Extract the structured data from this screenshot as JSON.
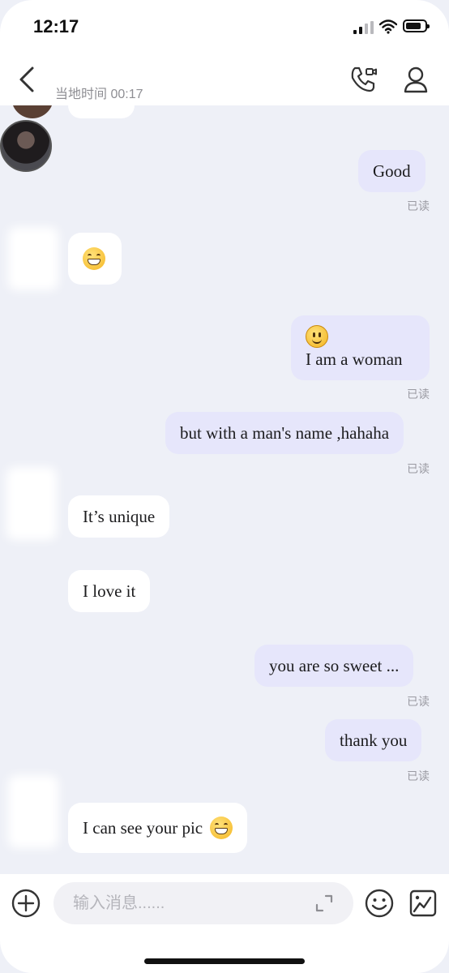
{
  "status_bar": {
    "time": "12:17"
  },
  "header": {
    "contact_name": "",
    "local_time": "当地时间 00:17"
  },
  "messages": [
    {
      "side": "out",
      "text": "Good",
      "read": "已读"
    },
    {
      "side": "in",
      "emoji": "grinning-face"
    },
    {
      "side": "out",
      "emoji": "smiling-face",
      "text": "I am a woman",
      "read": "已读"
    },
    {
      "side": "out",
      "text": "but with a man's name ,hahaha",
      "read": "已读"
    },
    {
      "side": "in",
      "text": "It’s unique"
    },
    {
      "side": "in",
      "text": "I love it"
    },
    {
      "side": "out",
      "text": "you are so sweet ...",
      "read": "已读"
    },
    {
      "side": "out",
      "text": "thank you",
      "read": "已读"
    },
    {
      "side": "in",
      "text": "I can see your pic",
      "emoji": "grinning-face"
    }
  ],
  "composer": {
    "placeholder": "输入消息......"
  },
  "colors": {
    "incoming": "#ffffff",
    "outgoing": "#e6e6fb",
    "background": "#eef0f7"
  }
}
